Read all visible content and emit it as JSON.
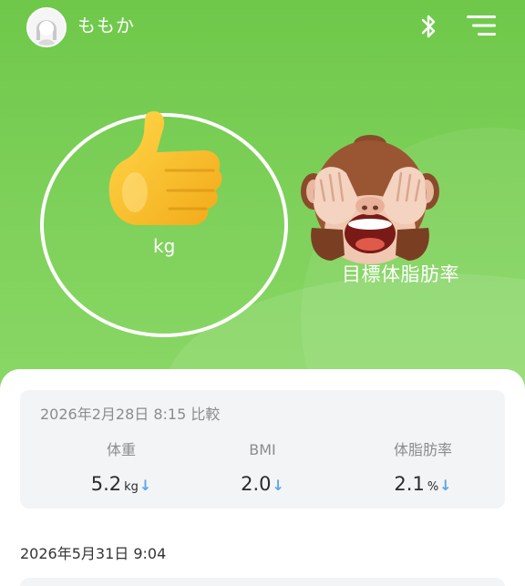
{
  "header": {
    "user_name": "ももか",
    "avatar_icon": "avatar-icon",
    "bluetooth_icon": "bluetooth-icon",
    "menu_icon": "menu-icon"
  },
  "hero": {
    "weight_unit": "kg",
    "thumb_icon": "thumbs-up-emoji",
    "monkey_icon": "see-no-evil-monkey-emoji",
    "target_label": "目標体脂肪率"
  },
  "comparison": {
    "title": "2026年2月28日 8:15 比較",
    "metrics": [
      {
        "name": "体重",
        "value": "5.2",
        "unit": "kg",
        "trend": "↓"
      },
      {
        "name": "BMI",
        "value": "2.0",
        "unit": "",
        "trend": "↓"
      },
      {
        "name": "体脂肪率",
        "value": "2.1",
        "unit": "%",
        "trend": "↓"
      }
    ]
  },
  "records": {
    "latest_date": "2026年5月31日 9:04"
  },
  "colors": {
    "brand_green": "#7dcd5a",
    "trend_blue": "#5aa8e8"
  }
}
